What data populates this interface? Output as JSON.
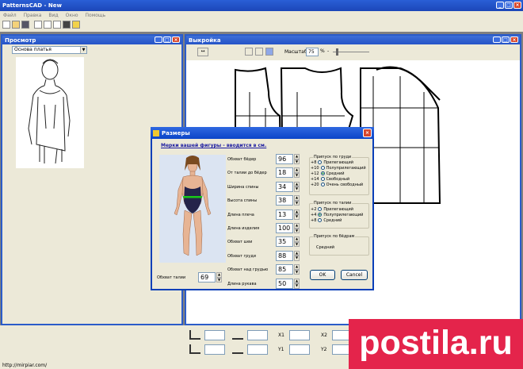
{
  "app": {
    "title": "PatternsCAD - New",
    "menu": [
      "Файл",
      "Правка",
      "Вид",
      "Окно",
      "Помощь"
    ]
  },
  "preview": {
    "title": "Просмотр",
    "dropdown": "Основа платья"
  },
  "pattern": {
    "title": "Выкройка",
    "scale_label": "Масштаб",
    "scale_value": "75",
    "scale_unit": "%",
    "zoom_minus": "-"
  },
  "dialog": {
    "title": "Размеры",
    "heading": "Мерки вашей фигуры - вводится в см.",
    "waist_label": "Обхват талии",
    "waist_value": "69",
    "measures": [
      {
        "label": "Обхват бёдер",
        "value": "96"
      },
      {
        "label": "От талии до бёдер",
        "value": "18"
      },
      {
        "label": "Ширина спины",
        "value": "34"
      },
      {
        "label": "Высота спины",
        "value": "38"
      },
      {
        "label": "Длина плеча",
        "value": "13"
      },
      {
        "label": "Длина изделия",
        "value": "100"
      },
      {
        "label": "Обхват шеи",
        "value": "35"
      },
      {
        "label": "Обхват груди",
        "value": "88"
      },
      {
        "label": "Обхват над грудью",
        "value": "85"
      },
      {
        "label": "Длина рукава",
        "value": "50"
      }
    ],
    "chest_group": {
      "title": "Припуск по груди",
      "options": [
        {
          "n": "+8",
          "label": "Прилегающий",
          "on": false
        },
        {
          "n": "+10",
          "label": "Полуприлегающий",
          "on": false
        },
        {
          "n": "+12",
          "label": "Средний",
          "on": true
        },
        {
          "n": "+14",
          "label": "Свободный",
          "on": false
        },
        {
          "n": "+20",
          "label": "Очень свободный",
          "on": false
        }
      ]
    },
    "waist_group": {
      "title": "Припуск по талии",
      "options": [
        {
          "n": "+2",
          "label": "Прилегающий",
          "on": false
        },
        {
          "n": "+4",
          "label": "Полуприлегающий",
          "on": true
        },
        {
          "n": "+8",
          "label": "Средний",
          "on": false
        }
      ]
    },
    "hips_group": {
      "title": "Припуск по бёдрам",
      "value": "Средний"
    },
    "ok": "OK",
    "cancel": "Cancel"
  },
  "bottom": {
    "x1": "X1",
    "x2": "X2",
    "y1": "Y1",
    "y2": "Y2"
  },
  "status": {
    "url": "http://mirpiar.com/"
  },
  "watermark": "postila.ru"
}
